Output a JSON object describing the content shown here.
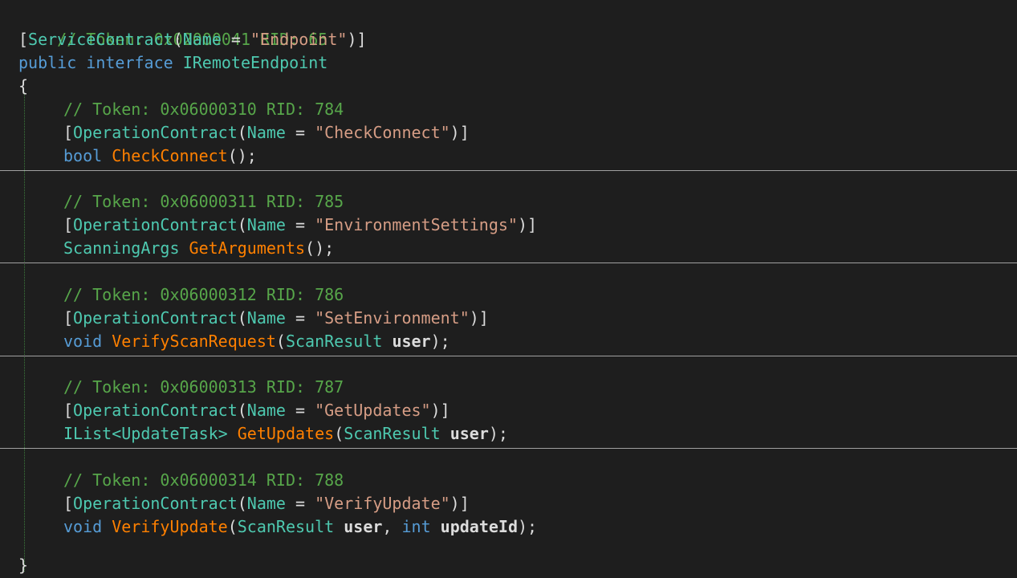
{
  "code": {
    "interface_comment": "// Token: 0x02000041 RID: 65",
    "service_attr": {
      "open": "[",
      "name": "ServiceContract",
      "paren_open": "(",
      "param": "Name",
      "eq": " = ",
      "value": "\"Endpoint\"",
      "close": ")]"
    },
    "interface_decl": {
      "modifiers": "public interface",
      "name": " IRemoteEndpoint"
    },
    "open_brace": "{",
    "close_brace": "}",
    "methods": [
      {
        "comment": "// Token: 0x06000310 RID: 784",
        "attr_name": "OperationContract",
        "attr_value": "\"CheckConnect\"",
        "return_type": "bool",
        "method_name": "CheckConnect",
        "params": "();"
      },
      {
        "comment": "// Token: 0x06000311 RID: 785",
        "attr_name": "OperationContract",
        "attr_value": "\"EnvironmentSettings\"",
        "return_type": "ScanningArgs",
        "method_name": "GetArguments",
        "params": "();"
      },
      {
        "comment": "// Token: 0x06000312 RID: 786",
        "attr_name": "OperationContract",
        "attr_value": "\"SetEnvironment\"",
        "return_type": "void",
        "method_name": "VerifyScanRequest",
        "param_type": "ScanResult",
        "param_name": "user",
        "params_close": ");"
      },
      {
        "comment": "// Token: 0x06000313 RID: 787",
        "attr_name": "OperationContract",
        "attr_value": "\"GetUpdates\"",
        "return_type_prefix": "IList<",
        "return_type_generic": "UpdateTask",
        "return_type_suffix": ">",
        "method_name": "GetUpdates",
        "param_type": "ScanResult",
        "param_name": "user",
        "params_close": ");"
      },
      {
        "comment": "// Token: 0x06000314 RID: 788",
        "attr_name": "OperationContract",
        "attr_value": "\"VerifyUpdate\"",
        "return_type": "void",
        "method_name": "VerifyUpdate",
        "param_type": "ScanResult",
        "param_name": "user",
        "param2_type": "int",
        "param2_name": "updateId",
        "params_close": ");"
      }
    ]
  },
  "colors": {
    "background": "#1e1e1e",
    "comment": "#57a64a",
    "keyword": "#569cd6",
    "type": "#4ec9b0",
    "string": "#d69d85",
    "method": "#ff8000"
  }
}
